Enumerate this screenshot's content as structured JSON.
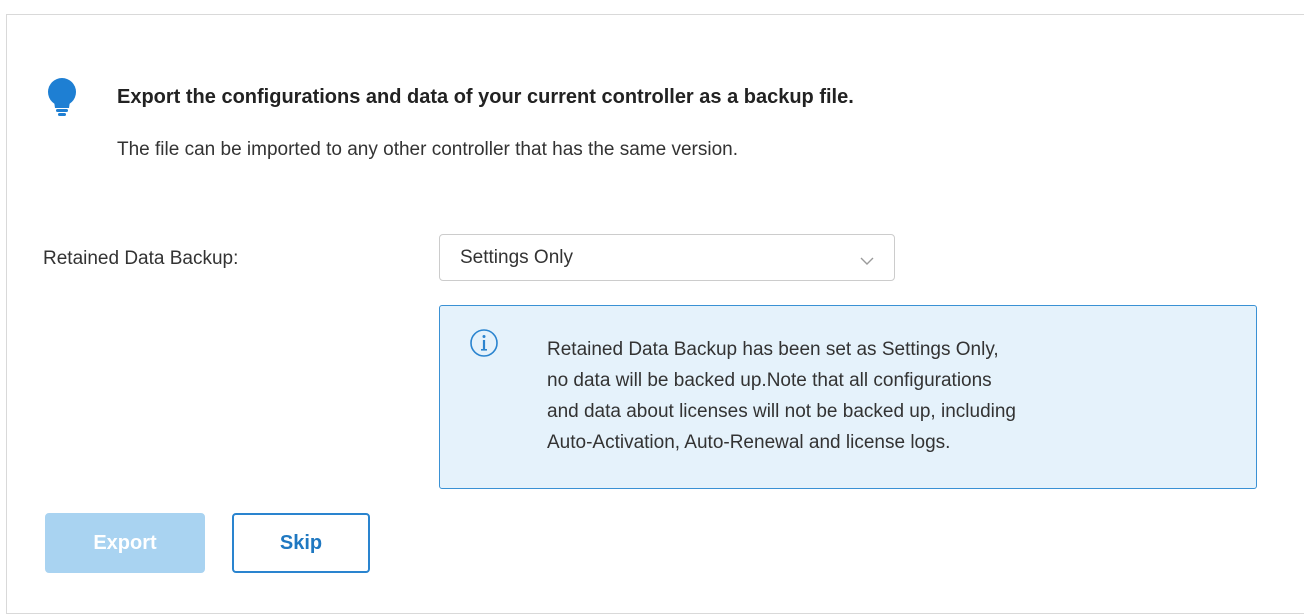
{
  "header": {
    "title": "Export the configurations and data of your current controller as a backup file.",
    "description": "The file can be imported to any other controller that has the same version.",
    "icon": "lightbulb-icon"
  },
  "form": {
    "retained_data_label": "Retained Data Backup:",
    "retained_data_value": "Settings Only"
  },
  "notice": {
    "icon": "info-icon",
    "lines": [
      "Retained Data Backup has been set as Settings Only,",
      "no data will be backed up.Note that all configurations",
      "and data about licenses will not be backed up, including",
      "Auto-Activation, Auto-Renewal and license logs."
    ]
  },
  "actions": {
    "export_label": "Export",
    "skip_label": "Skip"
  },
  "colors": {
    "accent": "#2a84cf",
    "notice_bg": "#e5f2fb",
    "notice_border": "#3a91d4",
    "disabled_button": "#a9d3f1"
  }
}
